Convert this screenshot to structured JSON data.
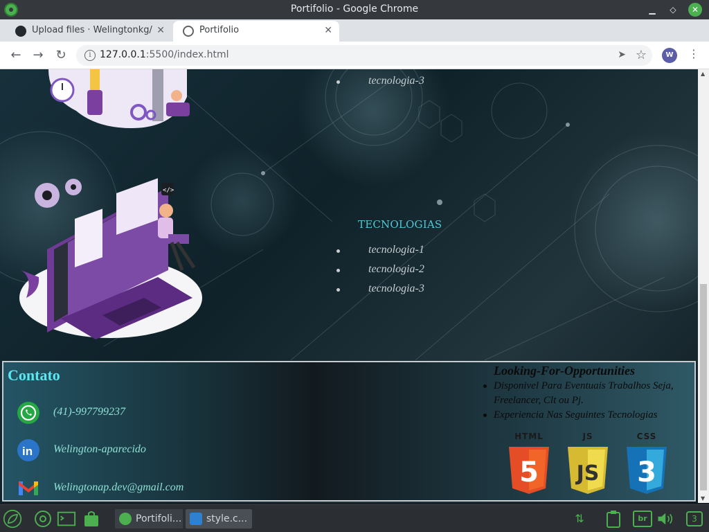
{
  "window": {
    "title": "Portifolio - Google Chrome"
  },
  "tabs": [
    {
      "label": "Upload files · Welingtonkg/",
      "active": false
    },
    {
      "label": "Portifolio",
      "active": true
    }
  ],
  "address_bar": {
    "host": "127.0.0.1",
    "path": ":5500/index.html"
  },
  "profile": {
    "initial": "W"
  },
  "page": {
    "top_item": "tecnologia-3",
    "tech_section": {
      "title": "TECNOLOGIAS",
      "items": [
        "tecnologia-1",
        "tecnologia-2",
        "tecnologia-3"
      ]
    },
    "footer": {
      "contato_title": "Contato",
      "contacts": [
        {
          "icon": "whatsapp-icon",
          "text": "(41)-997799237"
        },
        {
          "icon": "linkedin-icon",
          "text": "Welington-aparecido"
        },
        {
          "icon": "gmail-icon",
          "text": "Welingtonap.dev@gmail.com"
        }
      ],
      "looking_title": "Looking-For-Opportunities",
      "looking_items": [
        "Disponivel Para Eventuais Trabalhos Seja, Freelancer, Clt ou Pj.",
        "Experiencia Nas Seguintes Tecnologias"
      ],
      "badges": [
        {
          "tag": "HTML",
          "glyph": "5",
          "color": "#e44d26"
        },
        {
          "tag": "JS",
          "glyph": "JS",
          "color": "#f0db4f"
        },
        {
          "tag": "CSS",
          "glyph": "3",
          "color": "#2965f1"
        }
      ]
    }
  },
  "taskbar": {
    "tasks": [
      {
        "label": "Portifoli...",
        "icon": "chrome-icon"
      },
      {
        "label": "style.c...",
        "icon": "vscode-icon"
      }
    ],
    "tray": {
      "keyboard_layout": "br",
      "workspace": "3"
    }
  },
  "colors": {
    "accent_green": "#4caf50",
    "tech_title": "#4ec9d8",
    "contato_title": "#5ee6f0",
    "contact_text": "#8fe0d4"
  }
}
